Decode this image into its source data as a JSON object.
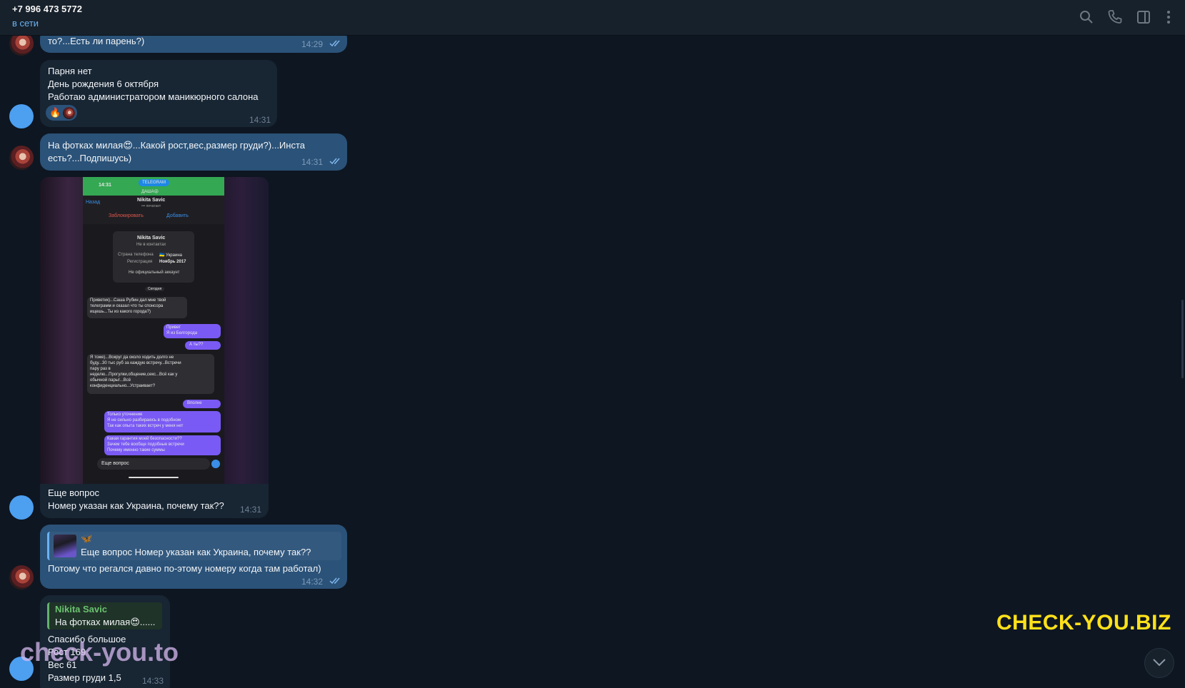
{
  "header": {
    "contact_name": "+7 996 473 5772",
    "status": "в сети",
    "icons": [
      "search-icon",
      "phone-icon",
      "sidebar-toggle-icon",
      "more-vertical-icon"
    ]
  },
  "messages": [
    {
      "id": "m1",
      "direction": "outgoing",
      "text": "то?...Есть ли парень?)",
      "time": "14:29",
      "read": true
    },
    {
      "id": "m2",
      "direction": "incoming",
      "lines": [
        "Парня нет",
        "День рождения 6 октября",
        "Работаю администратором маникюрного салона"
      ],
      "time": "14:31",
      "reactions": [
        "🔥"
      ]
    },
    {
      "id": "m3",
      "direction": "outgoing",
      "line1": "На фотках милая😍...Какой рост,вес,размер груди?)...Инста",
      "line2": "есть?...Подпишусь)",
      "time": "14:31",
      "read": true
    },
    {
      "id": "m4",
      "direction": "incoming",
      "has_photo": true,
      "lines": [
        "Еще вопрос",
        "Номер указан как Украина, почему так??"
      ],
      "time": "14:31"
    },
    {
      "id": "m5",
      "direction": "outgoing",
      "reply_sender": "🦋",
      "reply_text": "Еще вопрос  Номер указан как Украина, почему так??",
      "text": "Потому что регался давно по-этому номеру когда там работал)",
      "time": "14:32",
      "read": true
    },
    {
      "id": "m6",
      "direction": "incoming",
      "reply_sender": "Nikita Savic",
      "reply_text": "На фотках милая😍......",
      "lines": [
        "Спасибо большое",
        "Рост 169",
        "Вес 61",
        "Размер груди 1,5"
      ],
      "time": "14:33"
    }
  ],
  "screenshot": {
    "time": "14:31",
    "banner": "TELEGRAM",
    "chat_label": "ДАША😝",
    "back": "Назад",
    "name": "Nikita Savic",
    "typing": "••• печатает",
    "block": "Заблокировать",
    "add": "Добавить",
    "card_name": "Nikita Savic",
    "card_sub": "Не в контактах",
    "country_label": "Страна телефона",
    "country": "🇺🇦 Украина",
    "reg_label": "Регистрация",
    "reg": "Ноябрь 2017",
    "unofficial": "Не официальный аккаунт",
    "today": "Сегодня",
    "b1": [
      "Приветик)...Саша Рубин дал мне твой",
      "телеграмм и сказал что ты спонсора",
      "ищешь...Ты из какого города?)"
    ],
    "b2": [
      "Привет",
      "Я из Белгорода"
    ],
    "b3": "А ты??",
    "b4": [
      "Я тоже)...Вокруг да около ходить долго не",
      "буду...30 тыс руб за каждую встречу...Встречи",
      "пару раз в",
      "неделю...Прогулки,общение,секс...Всё как у",
      "обычной пары!...Всё",
      "конфиденциально...Устраивает?"
    ],
    "b5": "Вполне",
    "b6": [
      "Только уточнение",
      "Я не сильно разбираюсь в подобном",
      "Так как опыта таких встреч  у меня нет"
    ],
    "b7": [
      "Какая гарантия моей безопасности??",
      "Зачем тебе вообще подобные встречи",
      "Почему именно такие суммы"
    ],
    "input": "Еще вопрос"
  },
  "watermarks": {
    "right": "CHECK-YOU.BIZ",
    "left": "check-you.to"
  },
  "colors": {
    "background": "#0e1621",
    "header": "#17212b",
    "outgoing": "#2b5278",
    "incoming": "#182533",
    "accent": "#6ab2f2",
    "watermark": "#ffe11a"
  }
}
